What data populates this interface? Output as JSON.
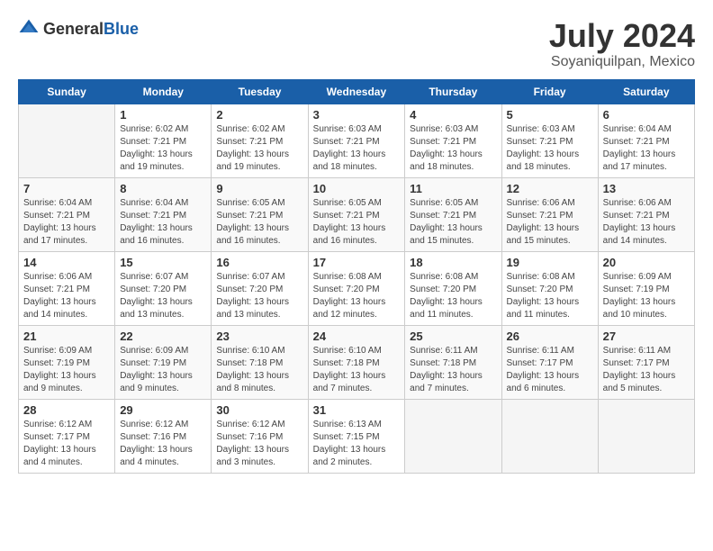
{
  "header": {
    "logo_general": "General",
    "logo_blue": "Blue",
    "title": "July 2024",
    "subtitle": "Soyaniquilpan, Mexico"
  },
  "days_of_week": [
    "Sunday",
    "Monday",
    "Tuesday",
    "Wednesday",
    "Thursday",
    "Friday",
    "Saturday"
  ],
  "weeks": [
    [
      {
        "day": "",
        "empty": true
      },
      {
        "day": "1",
        "sunrise": "6:02 AM",
        "sunset": "7:21 PM",
        "daylight": "13 hours and 19 minutes."
      },
      {
        "day": "2",
        "sunrise": "6:02 AM",
        "sunset": "7:21 PM",
        "daylight": "13 hours and 19 minutes."
      },
      {
        "day": "3",
        "sunrise": "6:03 AM",
        "sunset": "7:21 PM",
        "daylight": "13 hours and 18 minutes."
      },
      {
        "day": "4",
        "sunrise": "6:03 AM",
        "sunset": "7:21 PM",
        "daylight": "13 hours and 18 minutes."
      },
      {
        "day": "5",
        "sunrise": "6:03 AM",
        "sunset": "7:21 PM",
        "daylight": "13 hours and 18 minutes."
      },
      {
        "day": "6",
        "sunrise": "6:04 AM",
        "sunset": "7:21 PM",
        "daylight": "13 hours and 17 minutes."
      }
    ],
    [
      {
        "day": "7",
        "sunrise": "6:04 AM",
        "sunset": "7:21 PM",
        "daylight": "13 hours and 17 minutes."
      },
      {
        "day": "8",
        "sunrise": "6:04 AM",
        "sunset": "7:21 PM",
        "daylight": "13 hours and 16 minutes."
      },
      {
        "day": "9",
        "sunrise": "6:05 AM",
        "sunset": "7:21 PM",
        "daylight": "13 hours and 16 minutes."
      },
      {
        "day": "10",
        "sunrise": "6:05 AM",
        "sunset": "7:21 PM",
        "daylight": "13 hours and 16 minutes."
      },
      {
        "day": "11",
        "sunrise": "6:05 AM",
        "sunset": "7:21 PM",
        "daylight": "13 hours and 15 minutes."
      },
      {
        "day": "12",
        "sunrise": "6:06 AM",
        "sunset": "7:21 PM",
        "daylight": "13 hours and 15 minutes."
      },
      {
        "day": "13",
        "sunrise": "6:06 AM",
        "sunset": "7:21 PM",
        "daylight": "13 hours and 14 minutes."
      }
    ],
    [
      {
        "day": "14",
        "sunrise": "6:06 AM",
        "sunset": "7:21 PM",
        "daylight": "13 hours and 14 minutes."
      },
      {
        "day": "15",
        "sunrise": "6:07 AM",
        "sunset": "7:20 PM",
        "daylight": "13 hours and 13 minutes."
      },
      {
        "day": "16",
        "sunrise": "6:07 AM",
        "sunset": "7:20 PM",
        "daylight": "13 hours and 13 minutes."
      },
      {
        "day": "17",
        "sunrise": "6:08 AM",
        "sunset": "7:20 PM",
        "daylight": "13 hours and 12 minutes."
      },
      {
        "day": "18",
        "sunrise": "6:08 AM",
        "sunset": "7:20 PM",
        "daylight": "13 hours and 11 minutes."
      },
      {
        "day": "19",
        "sunrise": "6:08 AM",
        "sunset": "7:20 PM",
        "daylight": "13 hours and 11 minutes."
      },
      {
        "day": "20",
        "sunrise": "6:09 AM",
        "sunset": "7:19 PM",
        "daylight": "13 hours and 10 minutes."
      }
    ],
    [
      {
        "day": "21",
        "sunrise": "6:09 AM",
        "sunset": "7:19 PM",
        "daylight": "13 hours and 9 minutes."
      },
      {
        "day": "22",
        "sunrise": "6:09 AM",
        "sunset": "7:19 PM",
        "daylight": "13 hours and 9 minutes."
      },
      {
        "day": "23",
        "sunrise": "6:10 AM",
        "sunset": "7:18 PM",
        "daylight": "13 hours and 8 minutes."
      },
      {
        "day": "24",
        "sunrise": "6:10 AM",
        "sunset": "7:18 PM",
        "daylight": "13 hours and 7 minutes."
      },
      {
        "day": "25",
        "sunrise": "6:11 AM",
        "sunset": "7:18 PM",
        "daylight": "13 hours and 7 minutes."
      },
      {
        "day": "26",
        "sunrise": "6:11 AM",
        "sunset": "7:17 PM",
        "daylight": "13 hours and 6 minutes."
      },
      {
        "day": "27",
        "sunrise": "6:11 AM",
        "sunset": "7:17 PM",
        "daylight": "13 hours and 5 minutes."
      }
    ],
    [
      {
        "day": "28",
        "sunrise": "6:12 AM",
        "sunset": "7:17 PM",
        "daylight": "13 hours and 4 minutes."
      },
      {
        "day": "29",
        "sunrise": "6:12 AM",
        "sunset": "7:16 PM",
        "daylight": "13 hours and 4 minutes."
      },
      {
        "day": "30",
        "sunrise": "6:12 AM",
        "sunset": "7:16 PM",
        "daylight": "13 hours and 3 minutes."
      },
      {
        "day": "31",
        "sunrise": "6:13 AM",
        "sunset": "7:15 PM",
        "daylight": "13 hours and 2 minutes."
      },
      {
        "day": "",
        "empty": true
      },
      {
        "day": "",
        "empty": true
      },
      {
        "day": "",
        "empty": true
      }
    ]
  ],
  "labels": {
    "sunrise": "Sunrise:",
    "sunset": "Sunset:",
    "daylight": "Daylight:"
  }
}
